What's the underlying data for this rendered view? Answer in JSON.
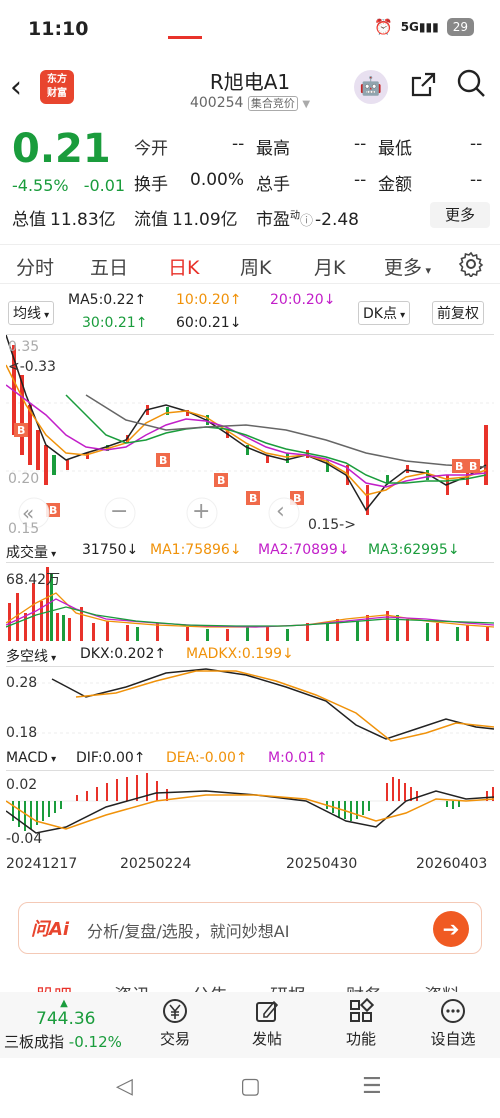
{
  "status": {
    "time": "11:10",
    "network": "5G",
    "battery": "29"
  },
  "header": {
    "title": "R旭电A1",
    "code": "400254",
    "tag": "集合竞价",
    "logo": "东方\n财富"
  },
  "quote": {
    "price": "0.21",
    "pct": "-4.55%",
    "chg": "-0.01",
    "open_label": "今开",
    "open": "--",
    "high_label": "最高",
    "high": "--",
    "low_label": "最低",
    "low": "--",
    "turnover_label": "换手",
    "turnover": "0.00%",
    "volume_label": "总手",
    "volume": "--",
    "amount_label": "金额",
    "amount": "--",
    "mktcap_label": "总值",
    "mktcap": "11.83亿",
    "float_label": "流值",
    "float": "11.09亿",
    "pe_label": "市盈",
    "pe_sup": "动",
    "pe": "-2.48",
    "more": "更多"
  },
  "tabs": [
    "分时",
    "五日",
    "日K",
    "周K",
    "月K",
    "更多"
  ],
  "kline": {
    "indicator": "均线",
    "ma5": "MA5:0.22↑",
    "ma10": "10:0.20↑",
    "ma20": "20:0.20↓",
    "ma30": "30:0.21↑",
    "ma60": "60:0.21↓",
    "dk": "DK点",
    "adjust": "前复权",
    "y_top": "0.35",
    "y_mid": "0.20",
    "y_bot": "0.15",
    "hi_mark": "<-0.33",
    "lo_mark": "0.15->"
  },
  "volume": {
    "label": "成交量",
    "value": "31750↓",
    "ma1": "MA1:75896↓",
    "ma2": "MA2:70899↓",
    "ma3": "MA3:62995↓",
    "y_top": "68.42万"
  },
  "dkx": {
    "label": "多空线",
    "dkx": "DKX:0.202↑",
    "madkx": "MADKX:0.199↓",
    "y_top": "0.28",
    "y_bot": "0.18"
  },
  "macd": {
    "label": "MACD",
    "dif": "DIF:0.00↑",
    "dea": "DEA:-0.00↑",
    "m": "M:0.01↑",
    "y_top": "0.02",
    "y_bot": "-0.04",
    "dates": [
      "20241217",
      "20250224",
      "20250430",
      "20260403"
    ]
  },
  "ai": {
    "logo": "问Ai",
    "placeholder": "分析/复盘/选股，就问妙想AI"
  },
  "cut_tabs": [
    "股吧",
    "资讯",
    "公告",
    "研报",
    "财务",
    "资料"
  ],
  "dock": {
    "index_value": "744.36",
    "index_name": "三板成指",
    "index_pct": "-0.12%",
    "items": [
      "交易",
      "发帖",
      "功能",
      "设自选"
    ]
  }
}
